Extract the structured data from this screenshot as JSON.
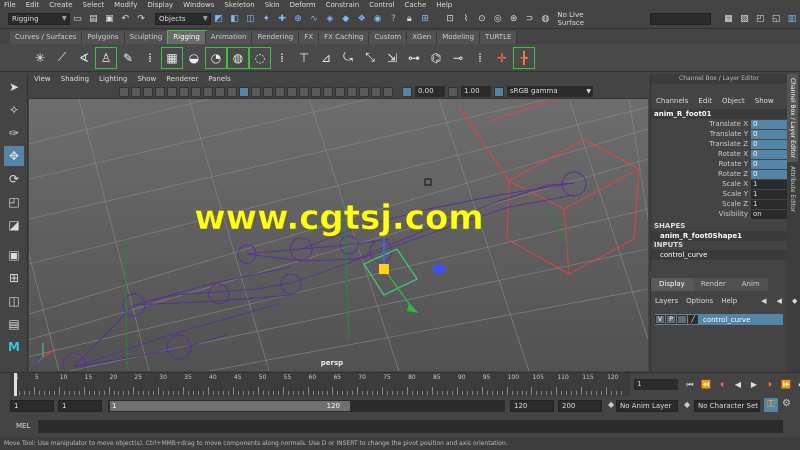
{
  "menubar": [
    "File",
    "Edit",
    "Create",
    "Select",
    "Modify",
    "Display",
    "Windows",
    "Skeleton",
    "Skin",
    "Deform",
    "Constrain",
    "Control",
    "Cache",
    "Help"
  ],
  "status": {
    "menuset": "Rigging",
    "selmode": "Objects",
    "live_surface": "No Live Surface"
  },
  "shelf_tabs": [
    "Curves / Surfaces",
    "Polygons",
    "Sculpting",
    "Rigging",
    "Animation",
    "Rendering",
    "FX",
    "FX Caching",
    "Custom",
    "XGen",
    "Modeling",
    "TURTLE"
  ],
  "shelf_active": "Rigging",
  "viewport": {
    "menus": [
      "View",
      "Shading",
      "Lighting",
      "Show",
      "Renderer",
      "Panels"
    ],
    "exposure": "0.00",
    "gamma": "1.00",
    "colorspace": "sRGB gamma",
    "camera": "persp",
    "watermark": "www.cgtsj.com"
  },
  "channelbox": {
    "title": "Channel Box / Layer Editor",
    "menus": [
      "Channels",
      "Edit",
      "Object",
      "Show"
    ],
    "object": "anim_R_foot01",
    "attrs": [
      {
        "label": "Translate X",
        "value": "0",
        "hl": true
      },
      {
        "label": "Translate Y",
        "value": "0",
        "hl": true
      },
      {
        "label": "Translate Z",
        "value": "0",
        "hl": true
      },
      {
        "label": "Rotate X",
        "value": "0",
        "hl": true
      },
      {
        "label": "Rotate Y",
        "value": "0",
        "hl": true
      },
      {
        "label": "Rotate Z",
        "value": "0",
        "hl": true
      },
      {
        "label": "Scale X",
        "value": "1",
        "hl": false
      },
      {
        "label": "Scale Y",
        "value": "1",
        "hl": false
      },
      {
        "label": "Scale Z",
        "value": "1",
        "hl": false
      },
      {
        "label": "Visibility",
        "value": "on",
        "hl": false
      }
    ],
    "shapes_label": "SHAPES",
    "shape": "anim_R_foot0Shape1",
    "inputs_label": "INPUTS",
    "input": "control_curve"
  },
  "sidetabs": [
    "Channel Box / Layer Editor",
    "Attribute Editor"
  ],
  "layers": {
    "tabs": [
      "Display",
      "Render",
      "Anim"
    ],
    "menus": [
      "Layers",
      "Options",
      "Help"
    ],
    "row": {
      "v": "V",
      "p": "P",
      "name": "control_curve"
    }
  },
  "timeslider": {
    "ticks": [
      1,
      5,
      10,
      15,
      20,
      25,
      30,
      35,
      40,
      45,
      50,
      55,
      60,
      65,
      70,
      75,
      80,
      85,
      90,
      95,
      100,
      105,
      110,
      115,
      120
    ],
    "current": 1,
    "current_frame_field": "1"
  },
  "range": {
    "start": "1",
    "start_inner": "1",
    "range_start": "1",
    "range_end": "120",
    "end_inner": "120",
    "end": "200",
    "anim_layer": "No Anim Layer",
    "char_set": "No Character Set"
  },
  "cmdline": {
    "label": "MEL"
  },
  "helpline": "Move Tool: Use manipulator to move object(s). Ctrl+MMB+drag to move components along normals. Use D or INSERT to change the pivot position and axis orientation."
}
